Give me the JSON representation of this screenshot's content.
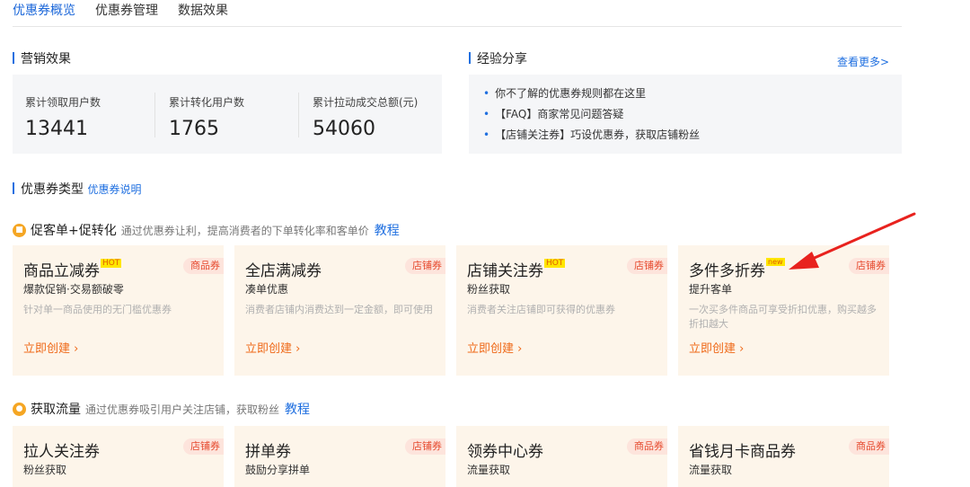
{
  "tabs": [
    {
      "label": "优惠券概览",
      "active": true
    },
    {
      "label": "优惠券管理",
      "active": false
    },
    {
      "label": "数据效果",
      "active": false
    }
  ],
  "marketing": {
    "title": "营销效果",
    "stats": [
      {
        "label": "累计领取用户数",
        "value": "13441"
      },
      {
        "label": "累计转化用户数",
        "value": "1765"
      },
      {
        "label": "累计拉动成交总额(元)",
        "value": "54060"
      }
    ]
  },
  "experience": {
    "title": "经验分享",
    "more": "查看更多>",
    "items": [
      "你不了解的优惠券规则都在这里",
      "【FAQ】商家常见问题答疑",
      "【店铺关注券】巧设优惠券，获取店铺粉丝"
    ]
  },
  "coupon_types": {
    "title": "优惠券类型",
    "explain_link": "优惠券说明"
  },
  "categories": [
    {
      "name": "促客单+促转化",
      "desc": "通过优惠券让利，提高消费者的下单转化率和客单价",
      "tutorial": "教程",
      "icon": "cart-icon",
      "cards": [
        {
          "name": "商品立减券",
          "badge": "HOT",
          "tag": "商品券",
          "sub": "爆款促销·交易额破零",
          "desc": "针对单一商品使用的无门槛优惠券",
          "cta": "立即创建"
        },
        {
          "name": "全店满减券",
          "badge": "",
          "tag": "店铺券",
          "sub": "凑单优惠",
          "desc": "消费者店铺内消费达到一定金额，即可使用",
          "cta": "立即创建"
        },
        {
          "name": "店铺关注券",
          "badge": "HOT",
          "tag": "店铺券",
          "sub": "粉丝获取",
          "desc": "消费者关注店铺即可获得的优惠券",
          "cta": "立即创建"
        },
        {
          "name": "多件多折券",
          "badge": "new",
          "tag": "店铺券",
          "sub": "提升客单",
          "desc": "一次买多件商品可享受折扣优惠，购买越多折扣越大",
          "cta": "立即创建"
        }
      ]
    },
    {
      "name": "获取流量",
      "desc": "通过优惠券吸引用户关注店铺，获取粉丝",
      "tutorial": "教程",
      "icon": "users-icon",
      "cards": [
        {
          "name": "拉人关注券",
          "badge": "",
          "tag": "店铺券",
          "sub": "粉丝获取"
        },
        {
          "name": "拼单券",
          "badge": "",
          "tag": "店铺券",
          "sub": "鼓励分享拼单"
        },
        {
          "name": "领券中心券",
          "badge": "",
          "tag": "商品券",
          "sub": "流量获取"
        },
        {
          "name": "省钱月卡商品券",
          "badge": "",
          "tag": "商品券",
          "sub": "流量获取"
        }
      ]
    }
  ],
  "colors": {
    "accent": "#1f6fe0",
    "cta": "#ef6a1a",
    "card_bg": "#fdf5ea",
    "arrow": "#e8221e"
  }
}
